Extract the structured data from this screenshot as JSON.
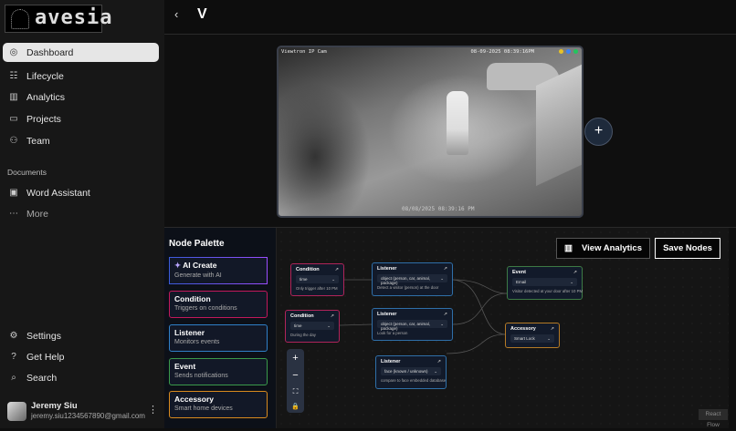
{
  "sidebar": {
    "logo_text": "avesia",
    "items": [
      {
        "label": "Dashboard",
        "icon": "dashboard-icon"
      },
      {
        "label": "Lifecycle",
        "icon": "list-icon"
      },
      {
        "label": "Analytics",
        "icon": "chart-icon"
      },
      {
        "label": "Projects",
        "icon": "folder-icon"
      },
      {
        "label": "Team",
        "icon": "users-icon"
      }
    ],
    "documents_label": "Documents",
    "documents": [
      {
        "label": "Word Assistant",
        "icon": "file-icon"
      },
      {
        "label": "More",
        "icon": "ellipsis-icon"
      }
    ],
    "bottom": [
      {
        "label": "Settings",
        "icon": "gear-icon"
      },
      {
        "label": "Get Help",
        "icon": "help-icon"
      },
      {
        "label": "Search",
        "icon": "search-icon"
      }
    ],
    "user": {
      "name": "Jeremy Siu",
      "email": "jeremy.siu1234567890@gmail.com"
    }
  },
  "header": {
    "back": "‹",
    "logo": "V"
  },
  "camera": {
    "name": "Viewtron IP Cam",
    "timestamp": "08-09-2025 08:39:16PM",
    "overlay_timestamp": "08/08/2025 08:39:16 PM",
    "add": "+"
  },
  "palette": {
    "title": "Node Palette",
    "items": [
      {
        "title": "AI Create",
        "subtitle": "Generate with AI",
        "color": "#7c4dff"
      },
      {
        "title": "Condition",
        "subtitle": "Triggers on conditions",
        "color": "#c2185b"
      },
      {
        "title": "Listener",
        "subtitle": "Monitors events",
        "color": "#2f80c8"
      },
      {
        "title": "Event",
        "subtitle": "Sends notifications",
        "color": "#3a9a4a"
      },
      {
        "title": "Accessory",
        "subtitle": "Smart home devices",
        "color": "#d88a1e"
      }
    ]
  },
  "actions": {
    "view_analytics": "View Analytics",
    "save_nodes": "Save Nodes"
  },
  "nodes": {
    "c1": {
      "title": "Condition",
      "select": "time",
      "desc": "Only trigger after 10 PM"
    },
    "l1": {
      "title": "Listener",
      "select": "object (person, car, animal, package)",
      "desc": "Detect a visitor (person) at the door"
    },
    "e1": {
      "title": "Event",
      "select": "Email",
      "desc": "Visitor detected at your door after 10 PM"
    },
    "c2": {
      "title": "Condition",
      "select": "time",
      "desc": "During the day"
    },
    "l2": {
      "title": "Listener",
      "select": "object (person, car, animal, package)",
      "desc": "Look for a person"
    },
    "a1": {
      "title": "Accessory",
      "select": "Smart Lock"
    },
    "l3": {
      "title": "Listener",
      "select": "face (known / unknown)",
      "desc": "compare to face embedded database"
    }
  },
  "controls": {
    "zoom_in": "+",
    "zoom_out": "−",
    "fit": "⛶",
    "lock": "🔒"
  },
  "attribution": "React Flow"
}
